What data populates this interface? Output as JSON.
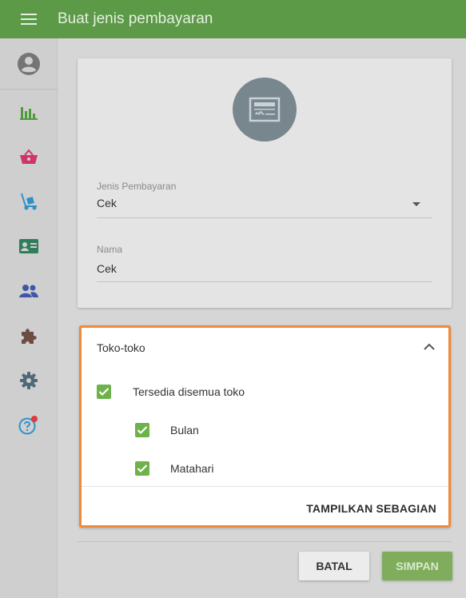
{
  "header": {
    "title": "Buat jenis pembayaran"
  },
  "sidebar": {
    "items": [
      {
        "icon": "account-circle-icon",
        "color": "#757575"
      },
      {
        "icon": "bar-chart-icon",
        "color": "#4f9a3c"
      },
      {
        "icon": "basket-icon",
        "color": "#d0356a"
      },
      {
        "icon": "hand-truck-icon",
        "color": "#2f8fc9"
      },
      {
        "icon": "contact-card-icon",
        "color": "#2e7d5b"
      },
      {
        "icon": "people-icon",
        "color": "#3e55a8"
      },
      {
        "icon": "puzzle-icon",
        "color": "#6d4c41"
      },
      {
        "icon": "gear-icon",
        "color": "#4f6a78"
      },
      {
        "icon": "help-icon",
        "color": "#2f8fc9"
      }
    ]
  },
  "form": {
    "payment_type_label": "Jenis Pembayaran",
    "payment_type_value": "Cek",
    "name_label": "Nama",
    "name_value": "Cek"
  },
  "stores": {
    "title": "Toko-toko",
    "all_label": "Tersedia disemua toko",
    "items": [
      {
        "label": "Bulan",
        "checked": true
      },
      {
        "label": "Matahari",
        "checked": true
      }
    ],
    "show_some_label": "TAMPILKAN SEBAGIAN"
  },
  "actions": {
    "cancel_label": "BATAL",
    "save_label": "SIMPAN"
  },
  "colors": {
    "accent": "#5c9a48",
    "highlight": "#ef8a3a",
    "check": "#6db24a"
  }
}
